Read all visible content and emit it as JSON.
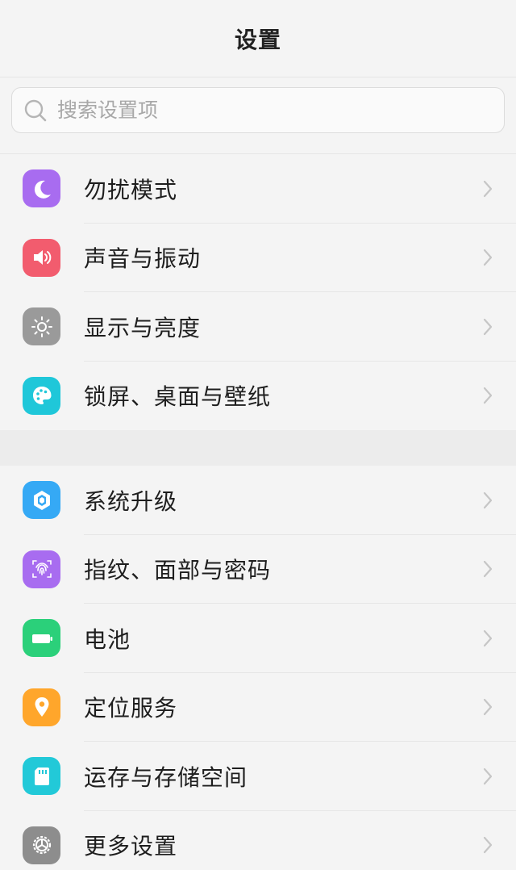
{
  "header": {
    "title": "设置"
  },
  "search": {
    "placeholder": "搜索设置项"
  },
  "groups": [
    {
      "items": [
        {
          "label": "勿扰模式",
          "icon": "moon-icon",
          "color": "#a86cf0"
        },
        {
          "label": "声音与振动",
          "icon": "speaker-icon",
          "color": "#f25c6e"
        },
        {
          "label": "显示与亮度",
          "icon": "sun-icon",
          "color": "#9a9a9a"
        },
        {
          "label": "锁屏、桌面与壁纸",
          "icon": "palette-icon",
          "color": "#1fc7d9"
        }
      ]
    },
    {
      "items": [
        {
          "label": "系统升级",
          "icon": "upgrade-icon",
          "color": "#35a9f5"
        },
        {
          "label": "指纹、面部与密码",
          "icon": "fingerprint-icon",
          "color": "#a86cf0"
        },
        {
          "label": "电池",
          "icon": "battery-icon",
          "color": "#2bd07a"
        },
        {
          "label": "定位服务",
          "icon": "location-pin-icon",
          "color": "#ffa62b"
        },
        {
          "label": "运存与存储空间",
          "icon": "sd-card-icon",
          "color": "#22c9d8"
        },
        {
          "label": "更多设置",
          "icon": "gear-icon",
          "color": "#8d8d8d"
        }
      ]
    }
  ]
}
